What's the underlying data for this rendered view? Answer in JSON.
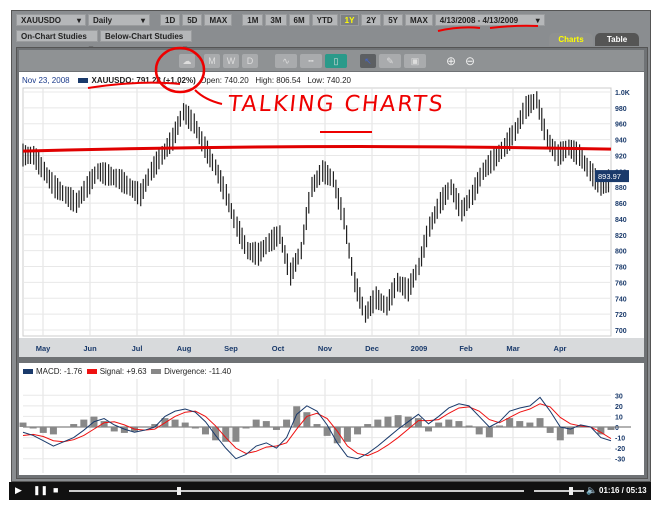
{
  "toolbar": {
    "symbol": "XAUUSDO",
    "interval": "Daily",
    "ranges_a": [
      "1D",
      "5D",
      "MAX"
    ],
    "ranges_b": [
      "1M",
      "3M",
      "6M",
      "YTD",
      "1Y",
      "2Y",
      "5Y",
      "MAX"
    ],
    "selected_range": "1Y",
    "date_range": "4/13/2008 - 4/13/2009",
    "on_chart": "On-Chart Studies",
    "below_chart": "Below-Chart Studies"
  },
  "tabs": {
    "charts": "Charts",
    "table": "Table"
  },
  "icon_toolbar": {
    "icons": [
      "talk-bubble-icon",
      "monthly-icon",
      "weekly-icon",
      "daily-icon",
      "line-chart-icon",
      "ohlc-chart-icon",
      "candle-chart-icon",
      "pointer-icon",
      "draw-tool-icon",
      "annotation-icon",
      "zoom-in-icon",
      "zoom-out-icon"
    ],
    "labels": {
      "m": "M",
      "w": "W",
      "d": "D"
    }
  },
  "legend": {
    "date": "Nov 23, 2008",
    "symbol_value": "XAUUSDO: 791.28 (+1.02%)",
    "open": "Open: 740.20",
    "high": "High: 806.54",
    "low": "Low: 740.20"
  },
  "price_label": "893.97",
  "annotation": "TALKING CHARTS",
  "colors": {
    "price": "#222222",
    "macd": "#1a3a6b",
    "signal": "#ee1111",
    "divergence": "#888888",
    "annotation": "#e00000"
  },
  "chart_data": [
    {
      "type": "line",
      "title": "XAUUSDO Daily 1Y",
      "x_labels": [
        "May",
        "Jun",
        "Jul",
        "Aug",
        "Sep",
        "Oct",
        "Nov",
        "Dec",
        "2009",
        "Feb",
        "Mar",
        "Apr"
      ],
      "y_ticks": [
        "1.0K",
        "980",
        "960",
        "940",
        "920",
        "900",
        "880",
        "860",
        "840",
        "820",
        "800",
        "780",
        "760",
        "740",
        "720",
        "700"
      ],
      "ylim": [
        700,
        1000
      ],
      "weekly_close": [
        920,
        900,
        880,
        870,
        860,
        880,
        900,
        895,
        890,
        880,
        870,
        900,
        920,
        940,
        975,
        960,
        930,
        905,
        870,
        830,
        800,
        795,
        810,
        820,
        770,
        800,
        880,
        900,
        890,
        840,
        760,
        720,
        740,
        730,
        760,
        750,
        780,
        830,
        860,
        880,
        850,
        870,
        900,
        915,
        930,
        950,
        980,
        990,
        940,
        920,
        930,
        920,
        900,
        880,
        890
      ],
      "reference_line": 928
    },
    {
      "type": "line",
      "title": "MACD",
      "legend": {
        "macd": "MACD: -1.76",
        "signal": "Signal: +9.63",
        "divergence": "Divergence: -11.40"
      },
      "y_ticks": [
        "30",
        "20",
        "10",
        "0",
        "-10",
        "-20",
        "-30"
      ],
      "ylim": [
        -35,
        35
      ],
      "macd": [
        -5,
        -8,
        -13,
        -18,
        -14,
        -10,
        -3,
        5,
        8,
        2,
        -2,
        -5,
        -3,
        0,
        10,
        15,
        17,
        14,
        5,
        -8,
        -20,
        -30,
        -26,
        -18,
        -15,
        -20,
        -10,
        12,
        20,
        15,
        2,
        -15,
        -28,
        -30,
        -25,
        -18,
        -10,
        -2,
        5,
        12,
        3,
        10,
        18,
        22,
        20,
        10,
        0,
        5,
        15,
        18,
        20,
        28,
        15,
        0,
        -2,
        2,
        0,
        -10,
        -13
      ],
      "signal": [
        -8,
        -7,
        -9,
        -13,
        -14,
        -12,
        -8,
        -2,
        4,
        5,
        2,
        -2,
        -3,
        -2,
        4,
        10,
        14,
        15,
        10,
        1,
        -10,
        -20,
        -25,
        -23,
        -19,
        -18,
        -15,
        -2,
        10,
        13,
        8,
        -4,
        -18,
        -25,
        -27,
        -23,
        -17,
        -10,
        -2,
        6,
        6,
        7,
        13,
        18,
        19,
        15,
        7,
        4,
        9,
        14,
        17,
        22,
        19,
        9,
        3,
        1,
        0,
        -5,
        -11
      ]
    }
  ]
}
